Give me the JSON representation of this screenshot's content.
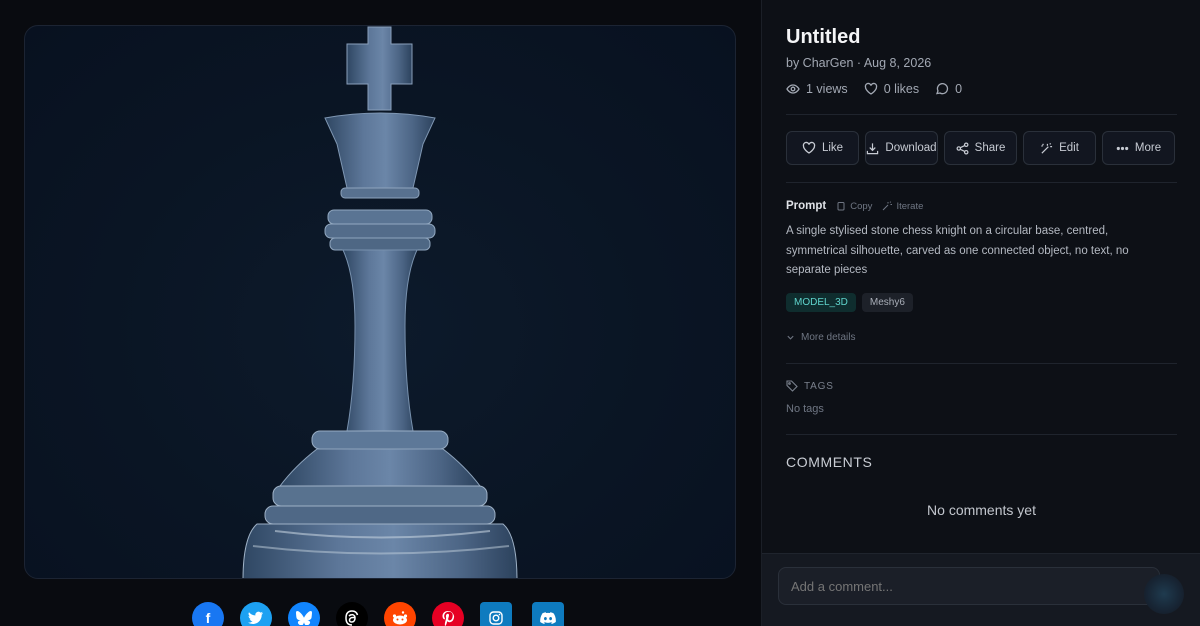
{
  "post": {
    "title": "Untitled",
    "byline": "by CharGen · Aug 8, 2026",
    "views": "1 views",
    "likes": "0 likes",
    "comments_count": "0"
  },
  "actions": {
    "like": "Like",
    "download": "Download",
    "share": "Share",
    "edit": "Edit",
    "more": "More"
  },
  "prompt": {
    "label": "Prompt",
    "copy": "Copy",
    "iterate": "Iterate",
    "text": "A single stylised stone chess knight on a circular base, centred, symmetrical silhouette, carved as one connected object, no text, no separate pieces"
  },
  "chips": {
    "model": "MODEL_3D",
    "generator": "Meshy6"
  },
  "more_details": "More details",
  "tags": {
    "label": "TAGS",
    "empty": "No tags"
  },
  "comments": {
    "label": "COMMENTS",
    "empty": "No comments yet",
    "placeholder": "Add a comment..."
  },
  "share_icons": [
    "facebook-icon",
    "twitter-icon",
    "bluesky-icon",
    "threads-icon",
    "reddit-icon",
    "pinterest-icon",
    "instagram-icon",
    "discord-icon"
  ],
  "colors": {
    "facebook": "#1877f2",
    "twitter": "#1da1f2",
    "bluesky": "#1185fe",
    "threads": "#000000",
    "reddit": "#ff4500",
    "pinterest": "#e60023",
    "instagram": "#0e7bbf",
    "discord": "#0e7bbf",
    "model_chip": "#5fd4cc"
  }
}
